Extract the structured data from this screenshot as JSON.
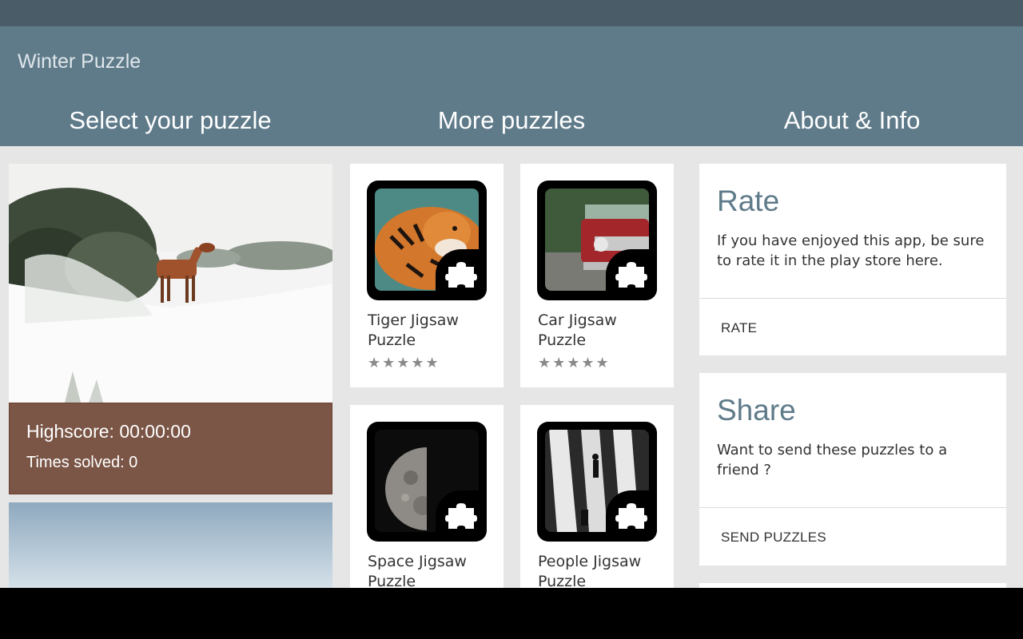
{
  "app": {
    "title": "Winter Puzzle"
  },
  "tabs": [
    {
      "label": "Select your puzzle"
    },
    {
      "label": "More puzzles"
    },
    {
      "label": "About & Info"
    }
  ],
  "puzzles": [
    {
      "highscore": "Highscore: 00:00:00",
      "times_solved": "Times solved: 0"
    }
  ],
  "more_puzzles": [
    {
      "name": "Tiger Jigsaw Puzzle",
      "stars": "★★★★★"
    },
    {
      "name": "Car Jigsaw Puzzle",
      "stars": "★★★★★"
    },
    {
      "name": "Space Jigsaw Puzzle"
    },
    {
      "name": "People Jigsaw Puzzle"
    }
  ],
  "about": {
    "rate": {
      "title": "Rate",
      "text": "If you have enjoyed this app, be sure to rate it in the play store here.",
      "action": "RATE"
    },
    "share": {
      "title": "Share",
      "text": "Want to send these puzzles to a friend ?",
      "action": "SEND PUZZLES"
    }
  },
  "colors": {
    "status_bar": "#4a5c68",
    "app_bar": "#5f7b8a",
    "content_bg": "#e6e6e6",
    "score_panel": "#7b5647",
    "accent_title": "#5f7b8a"
  }
}
